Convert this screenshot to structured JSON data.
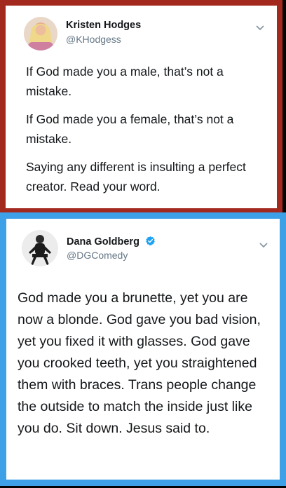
{
  "tweets": [
    {
      "display_name": "Kristen Hodges",
      "handle": "@KHodgess",
      "verified": false,
      "paragraphs": [
        "If God made you a male, that’s not a mistake.",
        "If God made you a female, that’s not a mistake.",
        "Saying any different is insulting a perfect creator. Read your word."
      ]
    },
    {
      "display_name": "Dana Goldberg",
      "handle": "@DGComedy",
      "verified": true,
      "text": "God made you a brunette, yet you are now a blonde. God gave you bad vision, yet you fixed it with glasses. God gave you crooked teeth, yet you straightened them with braces. Trans people change the outside to match the inside just like you do. Sit down. Jesus said to."
    }
  ],
  "colors": {
    "top_frame": "#a3291f",
    "bottom_frame": "#3ea0e6",
    "verified_badge": "#1da1f2"
  },
  "icons": [
    "chevron-down-icon",
    "verified-badge-icon",
    "avatar"
  ]
}
